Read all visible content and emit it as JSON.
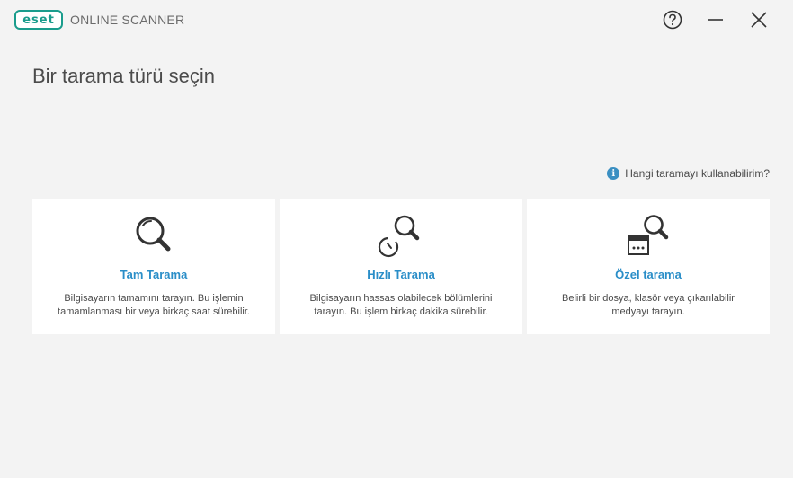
{
  "app": {
    "logo_text": "eset",
    "product_name": "ONLINE SCANNER",
    "brand_color": "#1a9c8c",
    "accent_color": "#2a8ec8"
  },
  "window_controls": {
    "help_icon": "question-circle-icon",
    "minimize_icon": "minimize-icon",
    "close_icon": "close-icon"
  },
  "page": {
    "title": "Bir tarama türü seçin",
    "help_link": "Hangi taramayı kullanabilirim?"
  },
  "cards": [
    {
      "icon": "magnifier-icon",
      "title": "Tam Tarama",
      "desc_line1": "Bilgisayarın tamamını tarayın. Bu işlemin",
      "desc_line2": "tamamlanması bir veya birkaç saat sürebilir."
    },
    {
      "icon": "quick-scan-icon",
      "title": "Hızlı Tarama",
      "desc_line1": "Bilgisayarın hassas olabilecek bölümlerini",
      "desc_line2": "tarayın. Bu işlem birkaç dakika sürebilir."
    },
    {
      "icon": "custom-scan-icon",
      "title": "Özel tarama",
      "desc_line1": "Belirli bir dosya, klasör veya çıkarılabilir",
      "desc_line2": "medyayı tarayın."
    }
  ]
}
